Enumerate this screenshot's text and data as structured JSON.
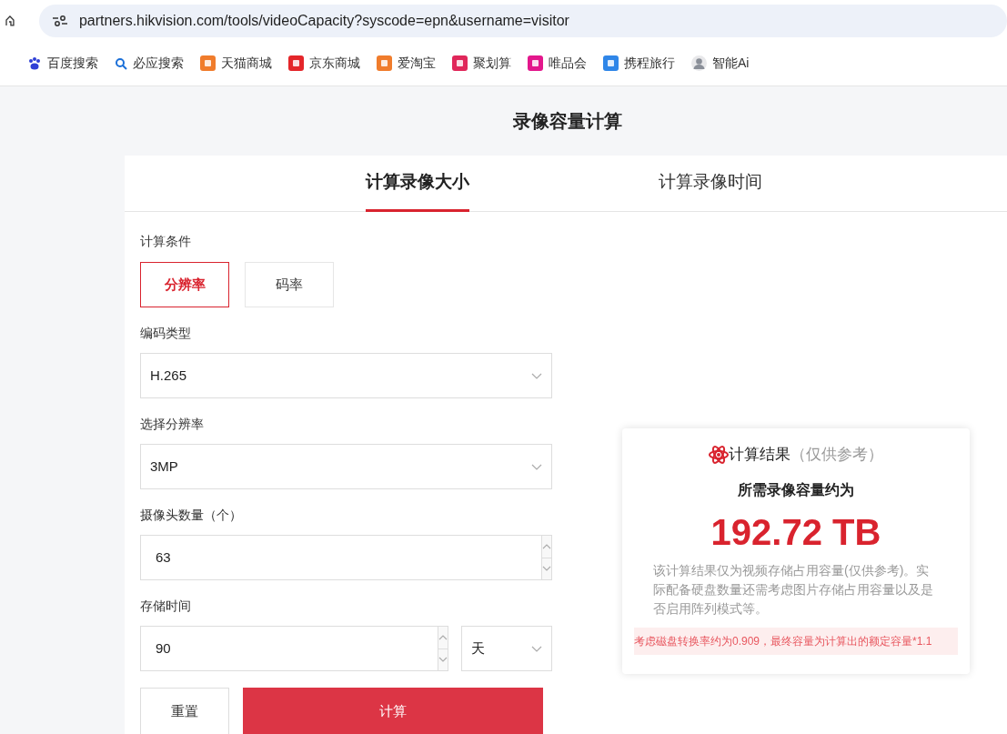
{
  "browser": {
    "url": "partners.hikvision.com/tools/videoCapacity?syscode=epn&username=visitor",
    "bookmarks": [
      {
        "kind": "paw",
        "label": "百度搜索",
        "color": "#2f3fd6"
      },
      {
        "kind": "search",
        "label": "必应搜索",
        "color": "#1a6fd8"
      },
      {
        "kind": "tile",
        "label": "天猫商城",
        "color": "#f07c2c"
      },
      {
        "kind": "tile",
        "label": "京东商城",
        "color": "#e4262a"
      },
      {
        "kind": "tile",
        "label": "爱淘宝",
        "color": "#f07c2c"
      },
      {
        "kind": "tile",
        "label": "聚划算",
        "color": "#e0275a"
      },
      {
        "kind": "tile",
        "label": "唯品会",
        "color": "#e3178c"
      },
      {
        "kind": "tile",
        "label": "携程旅行",
        "color": "#2f86e8"
      },
      {
        "kind": "avatar",
        "label": "智能Ai",
        "color": "#8a8f98"
      }
    ]
  },
  "page": {
    "title": "录像容量计算",
    "tabs": [
      {
        "label": "计算录像大小",
        "selected": true
      },
      {
        "label": "计算录像时间",
        "selected": false
      }
    ]
  },
  "form": {
    "mode_label": "计算条件",
    "modes": [
      {
        "label": "分辨率",
        "selected": true
      },
      {
        "label": "码率",
        "selected": false
      }
    ],
    "fields": [
      {
        "kind": "select",
        "label": "编码类型",
        "value": "H.265"
      },
      {
        "kind": "select",
        "label": "选择分辨率",
        "value": "3MP"
      },
      {
        "kind": "number",
        "label": "摄像头数量（个）",
        "value": "63"
      },
      {
        "kind": "number_unit",
        "label": "存储时间",
        "value": "90",
        "unit": "天"
      }
    ],
    "buttons": [
      {
        "kind": "secondary",
        "label": "重置"
      },
      {
        "kind": "primary",
        "label": "计算"
      }
    ]
  },
  "result": {
    "title": "计算结果",
    "subtitle": "（仅供参考）",
    "heading": "所需录像容量约为",
    "value": "192.72 TB",
    "note": "该计算结果仅为视频存储占用容量(仅供参考)。实际配备硬盘数量还需考虑图片存储占用容量以及是否启用阵列模式等。",
    "warning": "考虑磁盘转换率约为0.909，最终容量为计算出的额定容量*1.1"
  }
}
